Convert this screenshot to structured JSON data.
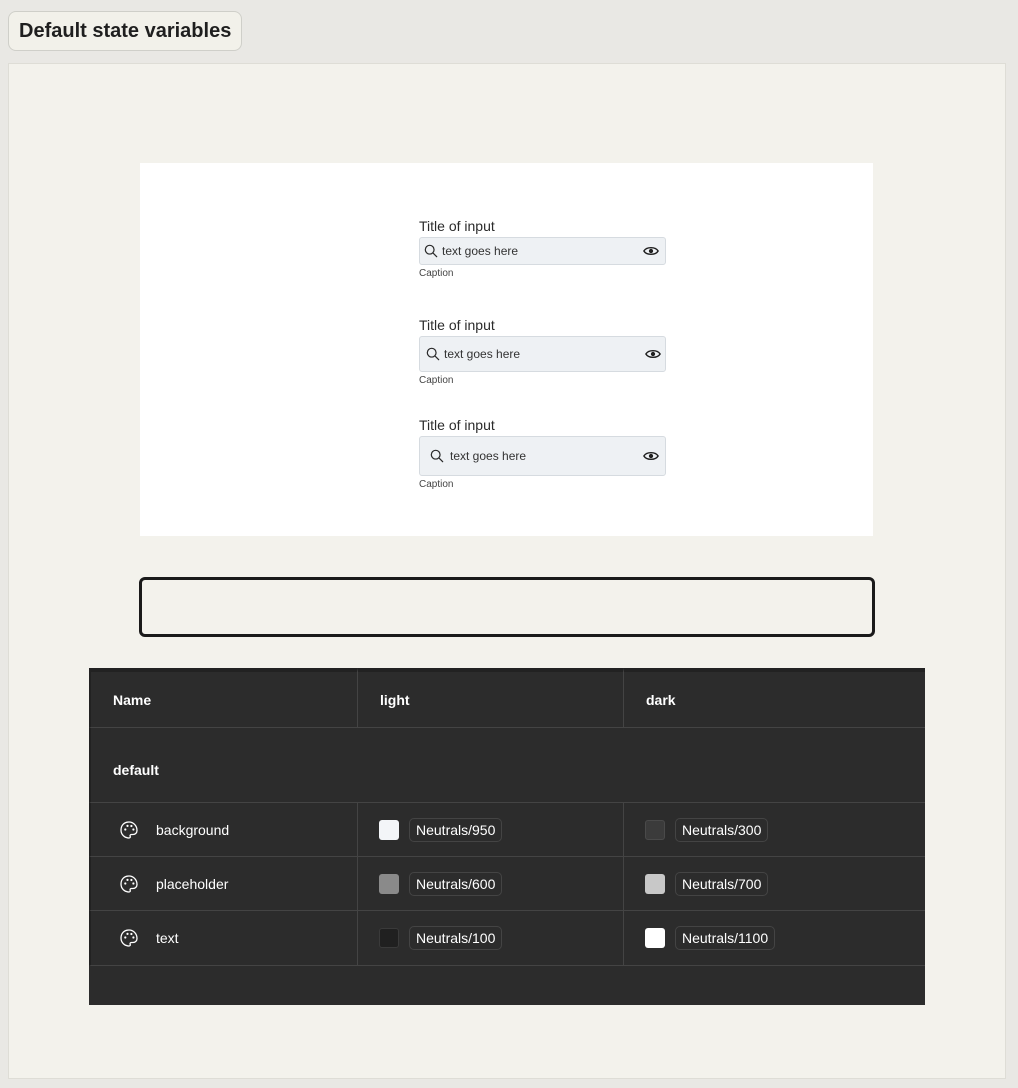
{
  "header": {
    "title": "Default state variables"
  },
  "preview": {
    "fields": [
      {
        "title": "Title of input",
        "placeholder": "text goes here",
        "caption": "Caption"
      },
      {
        "title": "Title of input",
        "placeholder": "text goes here",
        "caption": "Caption"
      },
      {
        "title": "Title of input",
        "placeholder": "text goes here",
        "caption": "Caption"
      }
    ]
  },
  "table": {
    "columns": [
      "Name",
      "light",
      "dark"
    ],
    "group": "default",
    "rows": [
      {
        "name": "background",
        "icon": "palette-icon",
        "light": {
          "label": "Neutrals/950",
          "color": "#f3f5f8"
        },
        "dark": {
          "label": "Neutrals/300",
          "color": "#3b3b3b"
        }
      },
      {
        "name": "placeholder",
        "icon": "palette-icon",
        "light": {
          "label": "Neutrals/600",
          "color": "#8a8a8a"
        },
        "dark": {
          "label": "Neutrals/700",
          "color": "#c8c8c8"
        }
      },
      {
        "name": "text",
        "icon": "palette-icon",
        "light": {
          "label": "Neutrals/100",
          "color": "#202020"
        },
        "dark": {
          "label": "Neutrals/1100",
          "color": "#ffffff"
        }
      }
    ]
  }
}
